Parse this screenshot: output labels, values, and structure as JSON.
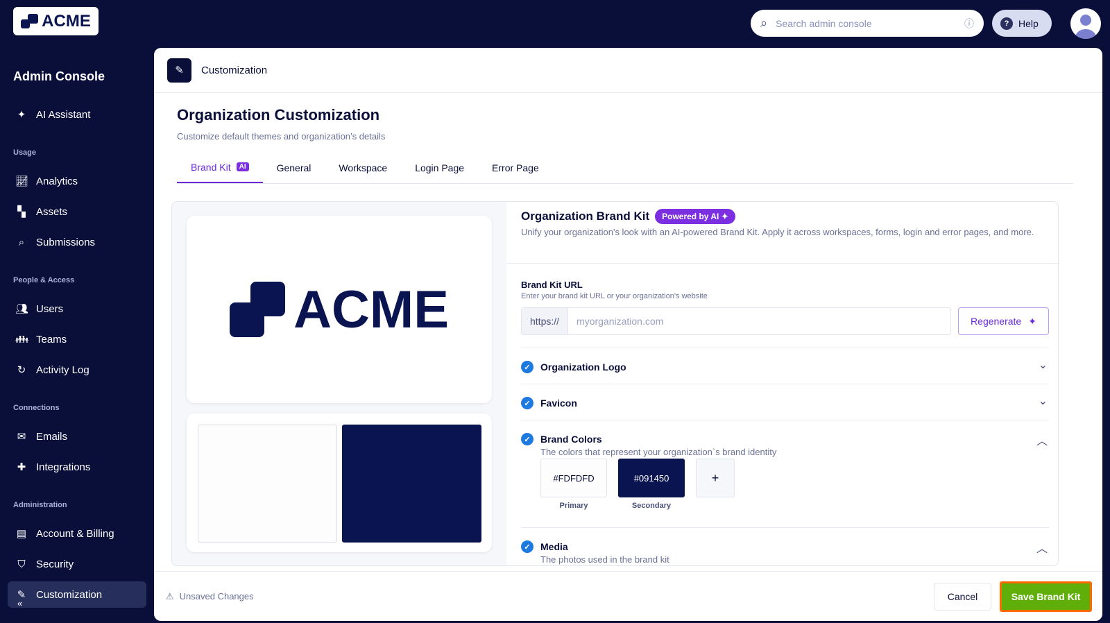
{
  "brand": {
    "logo_text": "ACME"
  },
  "sidebar": {
    "title": "Admin Console",
    "ai_assistant": "AI Assistant",
    "sections": {
      "usage": "Usage",
      "people": "People & Access",
      "connections": "Connections",
      "admin": "Administration"
    },
    "items": {
      "analytics": "Analytics",
      "assets": "Assets",
      "submissions": "Submissions",
      "users": "Users",
      "teams": "Teams",
      "activity": "Activity Log",
      "emails": "Emails",
      "integrations": "Integrations",
      "billing": "Account & Billing",
      "security": "Security",
      "customization": "Customization"
    }
  },
  "topbar": {
    "search_placeholder": "Search admin console",
    "help": "Help"
  },
  "page": {
    "header": "Customization",
    "title": "Organization Customization",
    "subtitle": "Customize default themes and organization’s details",
    "tabs": [
      "Brand Kit",
      "General",
      "Workspace",
      "Login Page",
      "Error Page"
    ],
    "ai_badge": "AI"
  },
  "brandkit": {
    "title": "Organization Brand Kit",
    "badge": "Powered by AI",
    "description": "Unify your organization's look with an AI-powered Brand Kit. Apply it across workspaces, forms, login and error pages, and more.",
    "url_label": "Brand Kit URL",
    "url_hint": "Enter your brand kit URL or your organization's website",
    "url_prefix": "https://",
    "url_placeholder": "myorganization.com",
    "regenerate": "Regenerate",
    "sections": {
      "logo": "Organization Logo",
      "favicon": "Favicon",
      "colors": "Brand Colors",
      "colors_desc": "The colors that represent your organization`s brand identity",
      "media": "Media",
      "media_desc": "The photos used in the brand kit"
    },
    "colors": [
      {
        "hex": "#FDFDFD",
        "name": "Primary"
      },
      {
        "hex": "#091450",
        "name": "Secondary"
      }
    ],
    "add": "+"
  },
  "footer": {
    "unsaved": "Unsaved Changes",
    "cancel": "Cancel",
    "save": "Save Brand Kit"
  }
}
